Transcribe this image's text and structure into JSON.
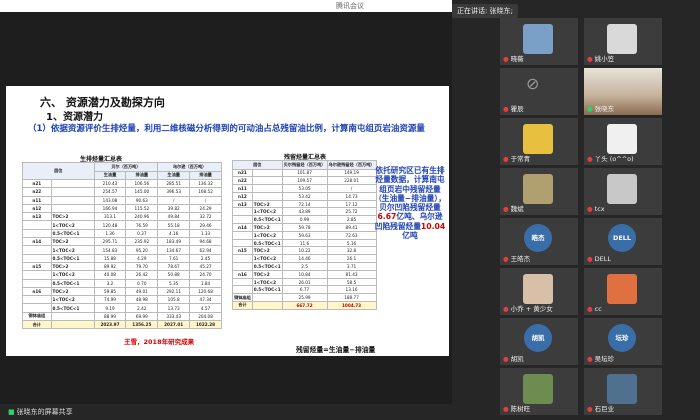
{
  "app": {
    "title": "腾讯会议"
  },
  "window_controls": {
    "minimize": "—",
    "maximize": "□",
    "close": "✕"
  },
  "speaker": {
    "label": "正在讲话:",
    "name": "张晓东;"
  },
  "share": {
    "label": "张晓东的屏幕共享"
  },
  "slide": {
    "heading": "六、 资源潜力及勘探方向",
    "subheading": "1、资源潜力",
    "lead": "（1）依据资源评价生排烃量，利用二维核磁分析得到的可动油占总残留油比例，计算南屯组页岩油资源量",
    "table1": {
      "title": "生排烃量汇总表",
      "h_layer": "层位",
      "h_group1": "贝尔（百万吨）",
      "h_group2": "乌尔逊（百万吨）",
      "h_gen": "生油量",
      "h_exp": "排油量",
      "rows": [
        [
          "n21",
          "",
          "210.43",
          "106.56",
          "285.51",
          "136.32"
        ],
        [
          "n22",
          "",
          "254.57",
          "145.00",
          "396.53",
          "168.52"
        ],
        [
          "n11",
          "",
          "143.08",
          "90.63",
          "/",
          "/"
        ],
        [
          "n12",
          "",
          "166.94",
          "115.52",
          "39.82",
          "24.29"
        ],
        [
          "n13",
          "TOC>2",
          "313.1",
          "240.96",
          "49.84",
          "32.72"
        ],
        [
          "",
          "1<TOC<2",
          "120.48",
          "76.59",
          "55.18",
          "29.46"
        ],
        [
          "",
          "0.5<TOC<1",
          "1.36",
          "0.37",
          "4.16",
          "1.33"
        ],
        [
          "n14",
          "TOC>2",
          "295.71",
          "235.92",
          "183.49",
          "94.68"
        ],
        [
          "",
          "1<TOC<2",
          "154.83",
          "95.20",
          "134.67",
          "62.94"
        ],
        [
          "",
          "0.5<TOC<1",
          "15.88",
          "4.29",
          "7.61",
          "2.45"
        ],
        [
          "n15",
          "TOC>2",
          "89.92",
          "79.70",
          "78.67",
          "45.27"
        ],
        [
          "",
          "1<TOC<2",
          "40.08",
          "26.42",
          "50.88",
          "24.70"
        ],
        [
          "",
          "0.5<TOC<1",
          "3.2",
          "0.70",
          "5.35",
          "1.84"
        ],
        [
          "n16",
          "TOC>2",
          "59.85",
          "49.01",
          "292.11",
          "120.68"
        ],
        [
          "",
          "1<TOC<2",
          "74.99",
          "48.98",
          "105.8",
          "47.34"
        ],
        [
          "",
          "0.5<TOC<1",
          "9.19",
          "2.42",
          "13.73",
          "4.57"
        ],
        [
          "铜钵庙组",
          "",
          "88.99",
          "69.99",
          "333.43",
          "204.08"
        ]
      ],
      "total": [
        "合计",
        "",
        "2023.97",
        "1356.25",
        "2027.01",
        "1022.28"
      ]
    },
    "table2": {
      "title": "残留烃量汇总表",
      "h_layer": "层位",
      "h_c1": "贝尔残留烃（百万吨）",
      "h_c2": "乌尔逊残留烃（百万吨）",
      "rows": [
        [
          "n21",
          "",
          "101.87",
          "149.19"
        ],
        [
          "n22",
          "",
          "109.57",
          "228.01"
        ],
        [
          "n11",
          "",
          "53.05",
          "/"
        ],
        [
          "n12",
          "",
          "53.42",
          "14.73"
        ],
        [
          "n13",
          "TOC>2",
          "72.14",
          "17.12"
        ],
        [
          "",
          "1<TOC<2",
          "43.89",
          "25.72"
        ],
        [
          "",
          "0.5<TOC<1",
          "0.99",
          "2.85"
        ],
        [
          "n14",
          "TOC>2",
          "59.78",
          "89.41"
        ],
        [
          "",
          "1<TOC<2",
          "59.63",
          "72.63"
        ],
        [
          "",
          "0.5<TOC<1",
          "11.6",
          "5.16"
        ],
        [
          "n15",
          "TOC>2",
          "10.22",
          "32.8"
        ],
        [
          "",
          "1<TOC<2",
          "14.46",
          "26.1"
        ],
        [
          "",
          "0.5<TOC<1",
          "2.5",
          "3.71"
        ],
        [
          "n16",
          "TOC>2",
          "10.84",
          "81.43"
        ],
        [
          "",
          "1<TOC<2",
          "26.01",
          "58.5"
        ],
        [
          "",
          "0.5<TOC<1",
          "6.77",
          "13.16"
        ],
        [
          "铜钵庙组",
          "",
          "25.99",
          "188.77"
        ]
      ],
      "total": [
        "合计",
        "",
        "667.72",
        "1004.73"
      ]
    },
    "note": {
      "part1": "依托研究区已有生排烃量数据，计算南屯组页岩中残留烃量（生油量−排油量），贝尔凹陷残留烃量",
      "val1": "6.67",
      "part2": "亿吨、乌尔逊凹陷残留烃量",
      "val2": "10.04",
      "part3": "亿吨"
    },
    "source": "王雪，2018年研究成果",
    "formula": "残留烃量=生油量−排油量"
  },
  "participants": [
    {
      "name": "晓薇",
      "avatar": "photo-avatar",
      "color": "#7aa0c8"
    },
    {
      "name": "姚小笠",
      "avatar": "photo-avatar",
      "color": "#d9d9d9"
    },
    {
      "name": "瞿辰",
      "avatar": "camera-off-icon"
    },
    {
      "name": "张晓东",
      "avatar": "video",
      "color": "#c4b19a",
      "speaking": true
    },
    {
      "name": "于常青",
      "avatar": "photo-avatar",
      "color": "#e8c040"
    },
    {
      "name": "丫头 (o^^o)",
      "avatar": "photo-avatar",
      "color": "#f0f0f0"
    },
    {
      "name": "魏斌",
      "avatar": "photo-avatar",
      "color": "#b0a070"
    },
    {
      "name": "tcx",
      "avatar": "photo-avatar",
      "color": "#c8c8c8"
    },
    {
      "name": "王皓杰",
      "avatar": "circle",
      "initials": "皓杰",
      "color": "#3a6ea8"
    },
    {
      "name": "DELL",
      "avatar": "circle",
      "initials": "DELL",
      "color": "#3a6ea8"
    },
    {
      "name": "小乔 + 黄少女",
      "avatar": "photo-avatar",
      "color": "#d8c0a8"
    },
    {
      "name": "cc",
      "avatar": "photo-avatar",
      "color": "#e07040"
    },
    {
      "name": "胡凯",
      "avatar": "circle",
      "initials": "胡凯",
      "color": "#3a6ea8"
    },
    {
      "name": "吴坛珍",
      "avatar": "circle",
      "initials": "坛珍",
      "color": "#3a6ea8"
    },
    {
      "name": "陈树旺",
      "avatar": "photo-avatar",
      "color": "#6c8c50"
    },
    {
      "name": "石巨业",
      "avatar": "photo-avatar",
      "color": "#507090"
    }
  ]
}
